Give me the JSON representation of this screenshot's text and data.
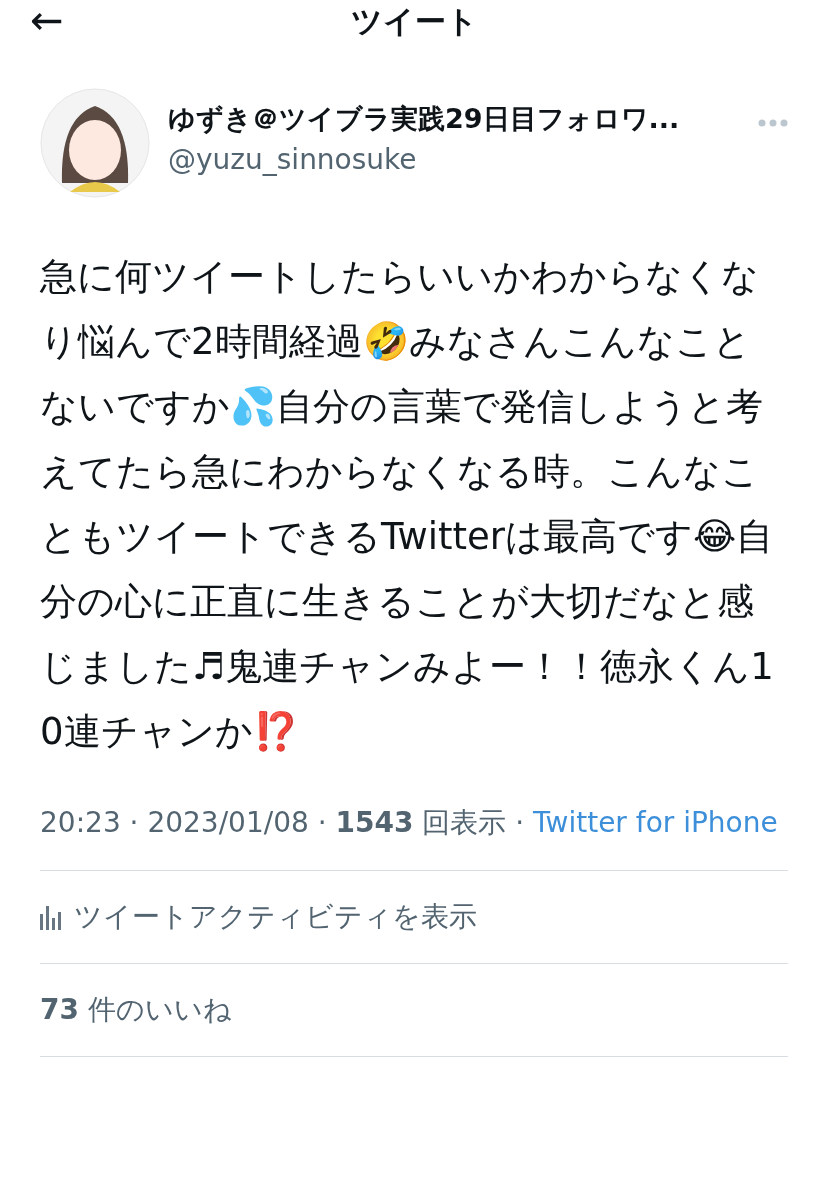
{
  "header": {
    "back_glyph": "←",
    "title": "ツイート"
  },
  "tweet": {
    "author": {
      "name": "ゆずき＠ツイブラ実践29日目フォロワ...",
      "handle": "@yuzu_sinnosuke"
    },
    "body": "急に何ツイートしたらいいかわからなくなり悩んで2時間経過🤣みなさんこんなことないですか💦自分の言葉で発信しようと考えてたら急にわからなくなる時。こんなこともツイートできるTwitterは最高です😂自分の心に正直に生きることが大切だなと感じました♬鬼連チャンみよー！！徳永くん10連チャンか⁉️",
    "meta": "20:23 · 2023/01/08 · **1543** 回表示 ·",
    "source": "Twitter for iPhone",
    "activity": "ツイートアクティビティを表示",
    "likes": "**73** 件のいいね"
  }
}
